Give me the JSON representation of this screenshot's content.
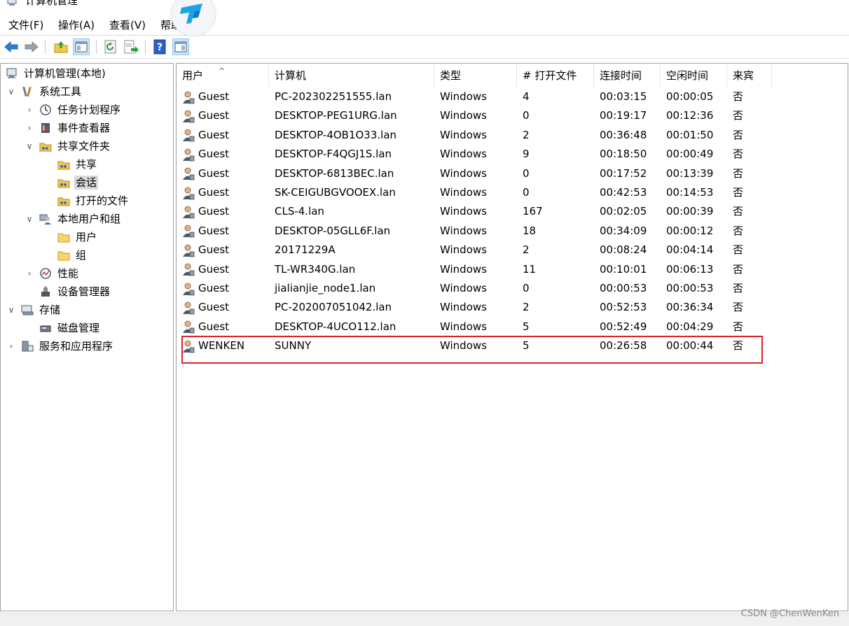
{
  "window": {
    "title": "计算机管理"
  },
  "menu": [
    "文件(F)",
    "操作(A)",
    "查看(V)",
    "帮助"
  ],
  "toolbar": {
    "buttons": [
      "back-arrow-icon",
      "forward-arrow-icon",
      "up-folder-icon",
      "show-hide-tree-icon",
      "refresh-icon",
      "export-list-icon",
      "help-icon",
      "show-hide-action-icon"
    ]
  },
  "tree": {
    "root": "计算机管理(本地)",
    "system_tools": "系统工具",
    "task_scheduler": "任务计划程序",
    "event_viewer": "事件查看器",
    "shared_folders": "共享文件夹",
    "shares": "共享",
    "sessions": "会话",
    "open_files": "打开的文件",
    "local_users": "本地用户和组",
    "users": "用户",
    "groups": "组",
    "performance": "性能",
    "device_manager": "设备管理器",
    "storage": "存储",
    "disk_management": "磁盘管理",
    "services_apps": "服务和应用程序"
  },
  "columns": {
    "user": "用户",
    "computer": "计算机",
    "type": "类型",
    "open_files": "# 打开文件",
    "connected": "连接时间",
    "idle": "空闲时间",
    "guest": "来宾"
  },
  "sessions": [
    {
      "user": "Guest",
      "computer": "PC-202302251555.lan",
      "type": "Windows",
      "open_files": "4",
      "connected": "00:03:15",
      "idle": "00:00:05",
      "guest": "否"
    },
    {
      "user": "Guest",
      "computer": "DESKTOP-PEG1URG.lan",
      "type": "Windows",
      "open_files": "0",
      "connected": "00:19:17",
      "idle": "00:12:36",
      "guest": "否"
    },
    {
      "user": "Guest",
      "computer": "DESKTOP-4OB1O33.lan",
      "type": "Windows",
      "open_files": "2",
      "connected": "00:36:48",
      "idle": "00:01:50",
      "guest": "否"
    },
    {
      "user": "Guest",
      "computer": "DESKTOP-F4QGJ1S.lan",
      "type": "Windows",
      "open_files": "9",
      "connected": "00:18:50",
      "idle": "00:00:49",
      "guest": "否"
    },
    {
      "user": "Guest",
      "computer": "DESKTOP-6813BEC.lan",
      "type": "Windows",
      "open_files": "0",
      "connected": "00:17:52",
      "idle": "00:13:39",
      "guest": "否"
    },
    {
      "user": "Guest",
      "computer": "SK-CEIGUBGVOOEX.lan",
      "type": "Windows",
      "open_files": "0",
      "connected": "00:42:53",
      "idle": "00:14:53",
      "guest": "否"
    },
    {
      "user": "Guest",
      "computer": "CLS-4.lan",
      "type": "Windows",
      "open_files": "167",
      "connected": "00:02:05",
      "idle": "00:00:39",
      "guest": "否"
    },
    {
      "user": "Guest",
      "computer": "DESKTOP-05GLL6F.lan",
      "type": "Windows",
      "open_files": "18",
      "connected": "00:34:09",
      "idle": "00:00:12",
      "guest": "否"
    },
    {
      "user": "Guest",
      "computer": "20171229A",
      "type": "Windows",
      "open_files": "2",
      "connected": "00:08:24",
      "idle": "00:04:14",
      "guest": "否"
    },
    {
      "user": "Guest",
      "computer": "TL-WR340G.lan",
      "type": "Windows",
      "open_files": "11",
      "connected": "00:10:01",
      "idle": "00:06:13",
      "guest": "否"
    },
    {
      "user": "Guest",
      "computer": "jialianjie_node1.lan",
      "type": "Windows",
      "open_files": "0",
      "connected": "00:00:53",
      "idle": "00:00:53",
      "guest": "否"
    },
    {
      "user": "Guest",
      "computer": "PC-202007051042.lan",
      "type": "Windows",
      "open_files": "2",
      "connected": "00:52:53",
      "idle": "00:36:34",
      "guest": "否"
    },
    {
      "user": "Guest",
      "computer": "DESKTOP-4UCO112.lan",
      "type": "Windows",
      "open_files": "5",
      "connected": "00:52:49",
      "idle": "00:04:29",
      "guest": "否"
    },
    {
      "user": "WENKEN",
      "computer": "SUNNY",
      "type": "Windows",
      "open_files": "5",
      "connected": "00:26:58",
      "idle": "00:00:44",
      "guest": "否"
    }
  ],
  "watermark": "CSDN @ChenWenKen",
  "colors": {
    "highlight": "#d8232a",
    "selection": "#d9d9d9",
    "toolbar_active": "#cce4f7"
  }
}
